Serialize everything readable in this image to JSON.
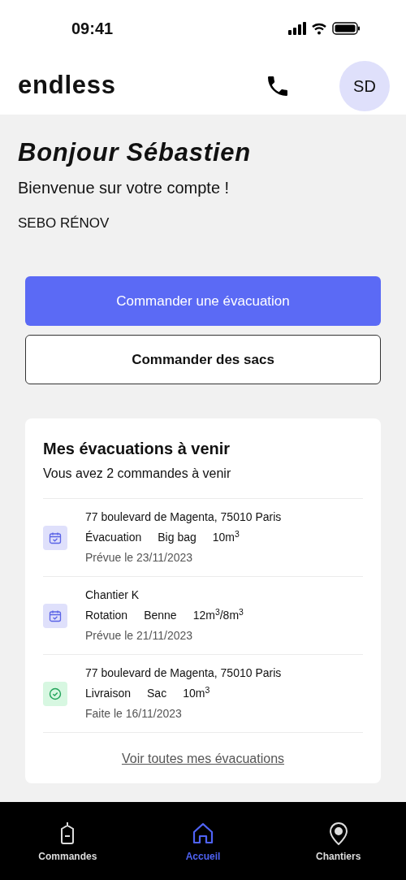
{
  "status_bar": {
    "time": "09:41"
  },
  "header": {
    "logo": "endless",
    "avatar": "SD"
  },
  "greeting": {
    "title": "Bonjour Sébastien",
    "subtitle": "Bienvenue sur votre compte !",
    "company": "SEBO RÉNOV"
  },
  "buttons": [
    {
      "label": "Commander une évacuation",
      "kind": "primary"
    },
    {
      "label": "Commander des sacs",
      "kind": "secondary"
    }
  ],
  "upcoming": {
    "title": "Mes évacuations à venir",
    "subtitle": "Vous avez 2 commandes à venir",
    "link": "Voir toutes mes évacuations",
    "items": [
      {
        "kind": "planned",
        "place": "77 boulevard de Magenta, 75010 Paris",
        "tags": [
          "Évacuation",
          "Big bag",
          "10m$^{3}$"
        ],
        "date": "Prévue le 23/11/2023"
      },
      {
        "kind": "planned",
        "place": "Chantier K",
        "tags": [
          "Rotation",
          "Benne",
          "12m$^{3}$/8m$^{3}$"
        ],
        "date": "Prévue le 21/11/2023"
      },
      {
        "kind": "done",
        "place": "77 boulevard de Magenta, 75010 Paris",
        "tags": [
          "Livraison",
          "Sac",
          "10m$^{3}$"
        ],
        "date": "Faite le 16/11/2023"
      }
    ]
  },
  "tab_bar": [
    {
      "label": "Commandes",
      "kind": "orders",
      "selected": false
    },
    {
      "label": "Accueil",
      "kind": "home",
      "selected": true
    },
    {
      "label": "Chantiers",
      "kind": "sites",
      "selected": false
    }
  ]
}
